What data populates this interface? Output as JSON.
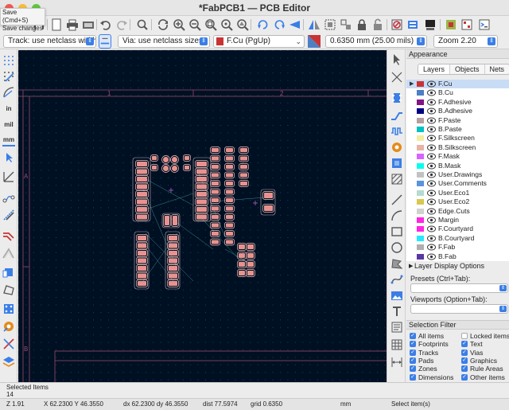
{
  "window": {
    "title": "*FabPCB1 — PCB Editor"
  },
  "tooltip": {
    "line1": "Save  (Cmd+S)",
    "line2": "Save changes"
  },
  "toolbar_icons": [
    "save-icon",
    "new-board-icon",
    "page-settings-icon",
    "print-icon",
    "plot-icon",
    "undo-icon",
    "redo-icon",
    "find-icon",
    "refresh-icon",
    "zoom-in-icon",
    "zoom-out-icon",
    "zoom-fit-icon",
    "zoom-objects-icon",
    "zoom-selection-icon",
    "rotate-ccw-icon",
    "rotate-cw-icon",
    "flip-icon",
    "mirror-icon",
    "group-icon",
    "ungroup-icon",
    "lock-icon",
    "unlock-icon",
    "drc-icon",
    "netlist-icon",
    "update-pcb-icon",
    "footprint-editor-icon",
    "scripting-icon"
  ],
  "toolbar2": {
    "track": "Track: use netclass width",
    "via": "Via: use netclass sizes",
    "layer": "F.Cu (PgUp)",
    "grid": "0.6350 mm (25.00 mils)",
    "zoom": "Zoom 2.20"
  },
  "left_toolbar": {
    "text_buttons": [
      "in",
      "mil",
      "mm"
    ]
  },
  "canvas": {
    "ruler_top": [
      "1",
      "2"
    ],
    "ruler_left": [
      "A",
      "B"
    ]
  },
  "appearance": {
    "title": "Appearance",
    "tabs": [
      "Layers",
      "Objects",
      "Nets"
    ],
    "active_tab": "Layers",
    "layers": [
      {
        "name": "F.Cu",
        "color": "#c83434",
        "selected": true
      },
      {
        "name": "B.Cu",
        "color": "#4d7fc4"
      },
      {
        "name": "F.Adhesive",
        "color": "#841384"
      },
      {
        "name": "B.Adhesive",
        "color": "#000082"
      },
      {
        "name": "F.Paste",
        "color": "#b4a0a0"
      },
      {
        "name": "B.Paste",
        "color": "#00c2c2"
      },
      {
        "name": "F.Silkscreen",
        "color": "#f2eda1"
      },
      {
        "name": "B.Silkscreen",
        "color": "#e8b2a7"
      },
      {
        "name": "F.Mask",
        "color": "#d864ff"
      },
      {
        "name": "B.Mask",
        "color": "#02ffee"
      },
      {
        "name": "User.Drawings",
        "color": "#c2c2c2"
      },
      {
        "name": "User.Comments",
        "color": "#5994dc"
      },
      {
        "name": "User.Eco1",
        "color": "#b4dbd2"
      },
      {
        "name": "User.Eco2",
        "color": "#d8c852"
      },
      {
        "name": "Edge.Cuts",
        "color": "#d0d2cd"
      },
      {
        "name": "Margin",
        "color": "#ff26e2"
      },
      {
        "name": "F.Courtyard",
        "color": "#ff26e2"
      },
      {
        "name": "B.Courtyard",
        "color": "#26e9ff"
      },
      {
        "name": "F.Fab",
        "color": "#afafaf"
      },
      {
        "name": "B.Fab",
        "color": "#5838a2"
      }
    ],
    "layer_display_options": "Layer Display Options",
    "presets_label": "Presets (Ctrl+Tab):",
    "viewports_label": "Viewports (Option+Tab):"
  },
  "selection_filter": {
    "title": "Selection Filter",
    "items": [
      {
        "label": "All items",
        "checked": true
      },
      {
        "label": "Locked items",
        "checked": false
      },
      {
        "label": "Footprints",
        "checked": true
      },
      {
        "label": "Text",
        "checked": true
      },
      {
        "label": "Tracks",
        "checked": true
      },
      {
        "label": "Vias",
        "checked": true
      },
      {
        "label": "Pads",
        "checked": true
      },
      {
        "label": "Graphics",
        "checked": true
      },
      {
        "label": "Zones",
        "checked": true
      },
      {
        "label": "Rule Areas",
        "checked": true
      },
      {
        "label": "Dimensions",
        "checked": true
      },
      {
        "label": "Other items",
        "checked": true
      }
    ]
  },
  "message_panel": {
    "label": "Selected Items",
    "value": "14"
  },
  "status": {
    "z": "Z 1.91",
    "xy": "X 62.2300  Y 46.3550",
    "dxy": "dx 62.2300  dy 46.3550",
    "dist": "dist 77.5974",
    "grid": "grid 0.6350",
    "units": "mm",
    "mode": "Select item(s)"
  }
}
